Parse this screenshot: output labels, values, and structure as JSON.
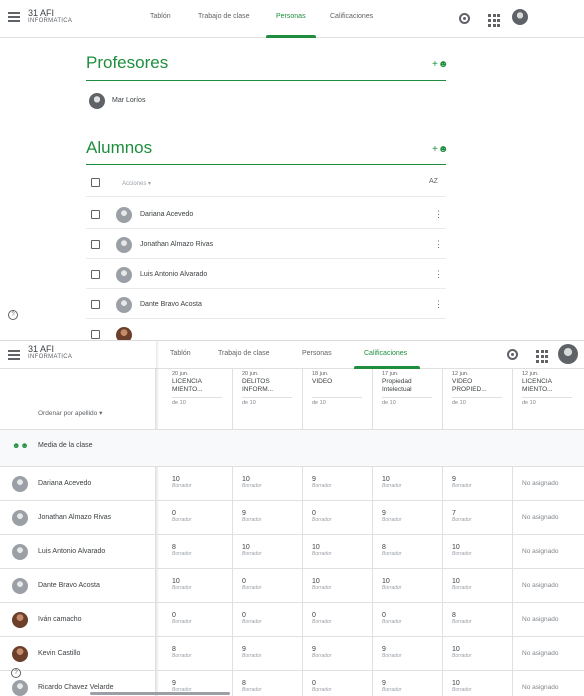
{
  "top": {
    "class_title": "31 AFI",
    "class_subtitle": "INFORMATICA",
    "tabs": [
      "Tablón",
      "Trabajo de clase",
      "Personas",
      "Calificaciones"
    ],
    "active_tab": 2,
    "teachers_title": "Profesores",
    "teacher_name": "Mar Loríos",
    "students_title": "Alumnos",
    "actions_label": "Acciones",
    "sort_icon_text": "AZ",
    "students": [
      "Dariana Acevedo",
      "Jonathan Almazo Rivas",
      "Luis Antonio Alvarado",
      "Dante Bravo Acosta",
      ""
    ]
  },
  "bottom": {
    "class_title": "31 AFI",
    "class_subtitle": "INFORMATICA",
    "tabs": [
      "Tablón",
      "Trabajo de clase",
      "Personas",
      "Calificaciones"
    ],
    "active_tab": 3,
    "sort_label": "Ordenar por apellido",
    "class_average": "Media de la clase",
    "assignments": [
      {
        "date": "20 jun.",
        "title": "LICENCIA MIENTO...",
        "out_of": "de 10"
      },
      {
        "date": "20 jun.",
        "title": "DELITOS INFORM...",
        "out_of": "de 10"
      },
      {
        "date": "18 jun.",
        "title": "VIDEO",
        "out_of": "de 10"
      },
      {
        "date": "17 jun.",
        "title": "Propiedad Intelectual",
        "out_of": "de 10"
      },
      {
        "date": "12 jun.",
        "title": "VIDEO PROPIED...",
        "out_of": "de 10"
      },
      {
        "date": "12 jun.",
        "title": "LICENCIA MIENTO...",
        "out_of": "de 10"
      }
    ],
    "draft_label": "Borrador",
    "not_assigned": "No asignado",
    "rows": [
      {
        "name": "Dariana Acevedo",
        "grades": [
          "10",
          "10",
          "9",
          "10",
          "9"
        ],
        "photo": false
      },
      {
        "name": "Jonathan Almazo Rivas",
        "grades": [
          "0",
          "9",
          "0",
          "9",
          "7"
        ],
        "photo": false
      },
      {
        "name": "Luis Antonio Alvarado",
        "grades": [
          "8",
          "10",
          "10",
          "8",
          "10"
        ],
        "photo": false
      },
      {
        "name": "Dante Bravo Acosta",
        "grades": [
          "10",
          "0",
          "10",
          "10",
          "10"
        ],
        "photo": false
      },
      {
        "name": "Iván camacho",
        "grades": [
          "0",
          "0",
          "0",
          "0",
          "8"
        ],
        "photo": true
      },
      {
        "name": "Kevin Castillo",
        "grades": [
          "8",
          "9",
          "9",
          "9",
          "10"
        ],
        "photo": true
      },
      {
        "name": "Ricardo Chavez Velarde",
        "grades": [
          "9",
          "8",
          "0",
          "9",
          "10"
        ],
        "photo": false
      }
    ]
  },
  "colors": {
    "accent": "#1e8e3e",
    "text": "#3c4043",
    "muted": "#5f6368"
  }
}
